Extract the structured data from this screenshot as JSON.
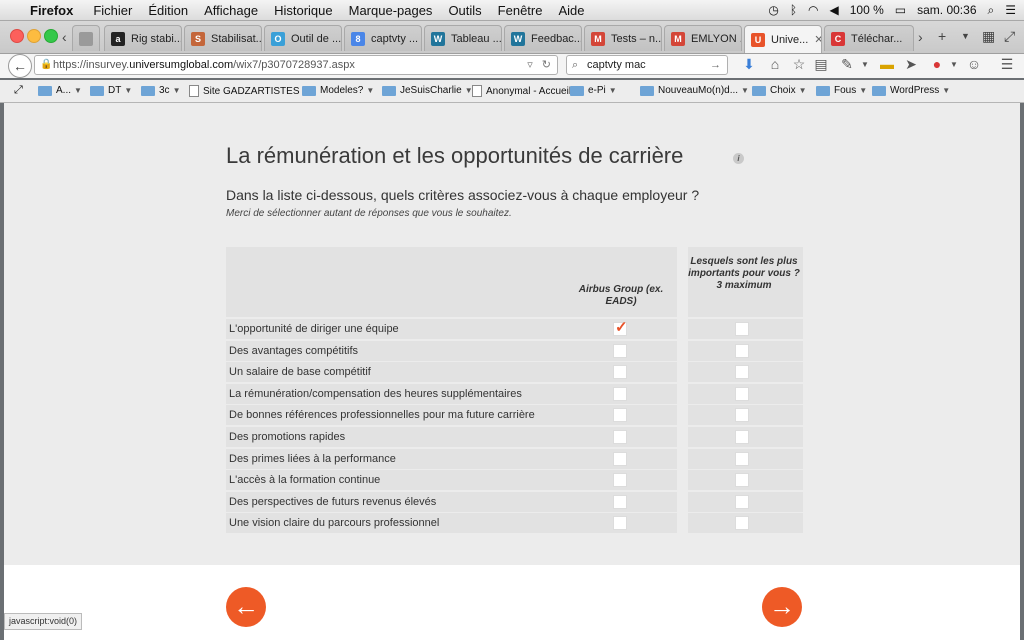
{
  "menubar": {
    "app": "Firefox",
    "items": [
      "Fichier",
      "Édition",
      "Affichage",
      "Historique",
      "Marque-pages",
      "Outils",
      "Fenêtre",
      "Aide"
    ],
    "battery": "100 %",
    "clock": "sam. 00:36"
  },
  "tabs": [
    {
      "label": "8 ...",
      "color": "#9a9a9a",
      "glyph": ""
    },
    {
      "label": "Rig stabi...",
      "color": "#222222",
      "glyph": "a"
    },
    {
      "label": "Stabilisat...",
      "color": "#c4663a",
      "glyph": "S"
    },
    {
      "label": "Outil de ...",
      "color": "#3aa0d8",
      "glyph": "O"
    },
    {
      "label": "captvty ...",
      "color": "#4a86e8",
      "glyph": "8"
    },
    {
      "label": "Tableau ...",
      "color": "#21759b",
      "glyph": "W"
    },
    {
      "label": "Feedbac...",
      "color": "#21759b",
      "glyph": "W"
    },
    {
      "label": "Tests – n...",
      "color": "#d44638",
      "glyph": "M"
    },
    {
      "label": "EMLYON ...",
      "color": "#d44638",
      "glyph": "M"
    },
    {
      "label": "Unive...",
      "color": "#e8532a",
      "glyph": "U",
      "active": true
    },
    {
      "label": "Téléchar...",
      "color": "#d93636",
      "glyph": "C"
    }
  ],
  "navbar": {
    "url_prefix": "https://insurvey.",
    "url_domain": "universumglobal.com",
    "url_path": "/wix7/p3070728937.aspx",
    "search_value": "captvty mac"
  },
  "bookmarks": [
    {
      "label": "A...",
      "type": "folder",
      "arrow": true
    },
    {
      "label": "DT",
      "type": "folder",
      "arrow": true
    },
    {
      "label": "3c",
      "type": "folder",
      "arrow": true
    },
    {
      "label": "Site GADZARTISTES",
      "type": "page",
      "arrow": false
    },
    {
      "label": "Modeles?",
      "type": "folder",
      "arrow": true
    },
    {
      "label": "JeSuisCharlie",
      "type": "folder",
      "arrow": true
    },
    {
      "label": "Anonymal - Accueil",
      "type": "page",
      "arrow": false
    },
    {
      "label": "e-Pi",
      "type": "folder",
      "arrow": true
    },
    {
      "label": "NouveauMo(n)d...",
      "type": "folder",
      "arrow": true
    },
    {
      "label": "Choix",
      "type": "folder",
      "arrow": true
    },
    {
      "label": "Fous",
      "type": "folder",
      "arrow": true
    },
    {
      "label": "WordPress",
      "type": "folder",
      "arrow": true
    }
  ],
  "survey": {
    "title": "La rémunération et les opportunités de carrière",
    "info_glyph": "i",
    "question": "Dans la liste ci-dessous, quels critères associez-vous à chaque employeur ?",
    "instruction": "Merci de sélectionner autant de réponses que vous le souhaitez.",
    "columns": [
      "Airbus Group (ex. EADS)",
      "Lesquels sont les plus importants pour vous ? 3 maximum"
    ],
    "rows": [
      {
        "label": "L'opportunité de diriger une équipe",
        "checked": [
          true,
          false
        ]
      },
      {
        "label": "Des avantages compétitifs",
        "checked": [
          false,
          false
        ]
      },
      {
        "label": "Un salaire de base compétitif",
        "checked": [
          false,
          false
        ]
      },
      {
        "label": "La rémunération/compensation des heures supplémentaires",
        "checked": [
          false,
          false
        ]
      },
      {
        "label": "De bonnes références professionnelles pour ma future carrière",
        "checked": [
          false,
          false
        ]
      },
      {
        "label": "Des promotions rapides",
        "checked": [
          false,
          false
        ]
      },
      {
        "label": "Des primes liées à la performance",
        "checked": [
          false,
          false
        ]
      },
      {
        "label": "L'accès à la formation continue",
        "checked": [
          false,
          false
        ]
      },
      {
        "label": "Des perspectives de futurs revenus élevés",
        "checked": [
          false,
          false
        ]
      },
      {
        "label": "Une vision claire du parcours professionnel",
        "checked": [
          false,
          false
        ]
      }
    ],
    "accent": "#ee5a26"
  },
  "statusbar": "javascript:void(0)"
}
